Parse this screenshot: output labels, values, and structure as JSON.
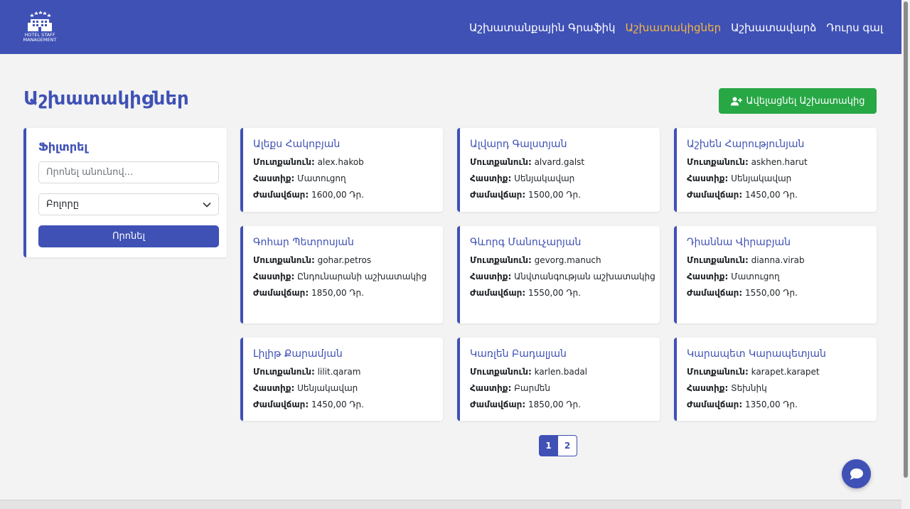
{
  "brand": {
    "logo_text_line1": "HOTEL STAFF",
    "logo_text_line2": "MANAGEMENT"
  },
  "nav": {
    "items": [
      {
        "label": "Աշխատանքային Գրաֆիկ",
        "active": false
      },
      {
        "label": "Աշխատակիցներ",
        "active": true
      },
      {
        "label": "Աշխատավարձ",
        "active": false
      },
      {
        "label": "Դուրս գալ",
        "active": false
      }
    ]
  },
  "page": {
    "title": "Աշխատակիցներ",
    "add_button_label": "Ավելացնել Աշխատակից"
  },
  "filter": {
    "title": "Ֆիլտրել",
    "search_placeholder": "Որոնել անունով...",
    "search_value": "",
    "role_selected": "Բոլորը",
    "search_button_label": "Որոնել"
  },
  "labels": {
    "username": "Մուտքանուն:",
    "position": "Հաստիք:",
    "hourly_rate": "Ժամավճար:"
  },
  "employees": [
    {
      "name": "Ալեքս Հակոբյան",
      "username": "alex.hakob",
      "position": "Մատուցող",
      "rate": "1600,00 Դր."
    },
    {
      "name": "Ալվարդ Գալստյան",
      "username": "alvard.galst",
      "position": "Սենյակավար",
      "rate": "1500,00 Դր."
    },
    {
      "name": "Աշխեն Հարությունյան",
      "username": "askhen.harut",
      "position": "Սենյակավար",
      "rate": "1450,00 Դր."
    },
    {
      "name": "Գոհար Պետրոսյան",
      "username": "gohar.petros",
      "position": "Ընդունարանի աշխատակից",
      "rate": "1850,00 Դր."
    },
    {
      "name": "Գևորգ Մանուչարյան",
      "username": "gevorg.manuch",
      "position": "Անվտանգության աշխատակից",
      "rate": "1550,00 Դր."
    },
    {
      "name": "Դիաննա Վիրաբյան",
      "username": "dianna.virab",
      "position": "Մատուցող",
      "rate": "1550,00 Դր."
    },
    {
      "name": "Լիլիթ Քարամյան",
      "username": "lilit.qaram",
      "position": "Սենյակավար",
      "rate": "1450,00 Դր."
    },
    {
      "name": "Կառլեն Բադալյան",
      "username": "karlen.badal",
      "position": "Բարմեն",
      "rate": "1850,00 Դր."
    },
    {
      "name": "Կարապետ Կարապետյան",
      "username": "karapet.karapet",
      "position": "Տեխնիկ",
      "rate": "1350,00 Դր."
    }
  ],
  "pagination": {
    "pages": [
      "1",
      "2"
    ],
    "current": "1"
  },
  "colors": {
    "primary": "#3f51b5",
    "accent": "#f5b642",
    "success": "#28a745"
  }
}
